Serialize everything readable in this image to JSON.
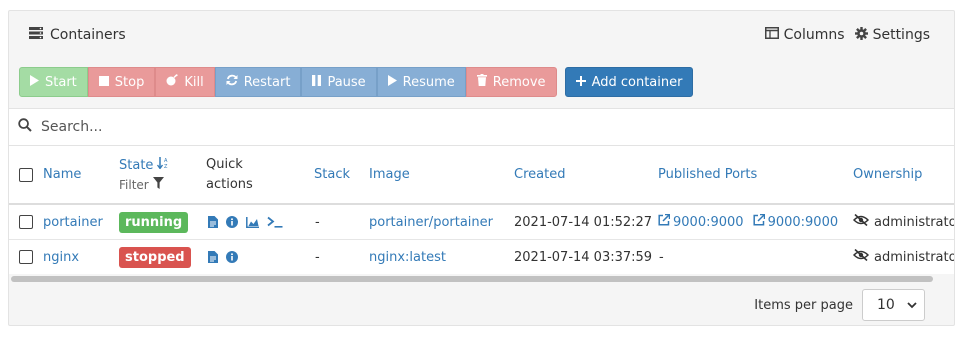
{
  "header": {
    "title": "Containers",
    "title_icon": "server-icon",
    "columns_label": "Columns",
    "settings_label": "Settings"
  },
  "toolbar": {
    "start": "Start",
    "stop": "Stop",
    "kill": "Kill",
    "restart": "Restart",
    "pause": "Pause",
    "resume": "Resume",
    "remove": "Remove",
    "add": "Add container"
  },
  "search": {
    "placeholder": "Search..."
  },
  "table": {
    "columns": {
      "name": "Name",
      "state": "State",
      "state_filter": "Filter",
      "quick_actions_1": "Quick",
      "quick_actions_2": "actions",
      "stack": "Stack",
      "image": "Image",
      "created": "Created",
      "ports": "Published Ports",
      "ownership": "Ownership"
    },
    "rows": [
      {
        "name": "portainer",
        "state": "running",
        "stack": "-",
        "image": "portainer/portainer",
        "created": "2021-07-14 01:52:27",
        "port_1": "9000:9000",
        "port_2": "9000:9000",
        "ownership": "administrato"
      },
      {
        "name": "nginx",
        "state": "stopped",
        "stack": "-",
        "image": "nginx:latest",
        "created": "2021-07-14 03:37:59",
        "ports": "-",
        "ownership": "administrato"
      }
    ]
  },
  "footer": {
    "items_per_page_label": "Items per page",
    "items_per_page": "10"
  },
  "colors": {
    "link": "#337ab7",
    "running": "#5cb85c",
    "stopped": "#d9534f",
    "primary": "#337ab7"
  }
}
